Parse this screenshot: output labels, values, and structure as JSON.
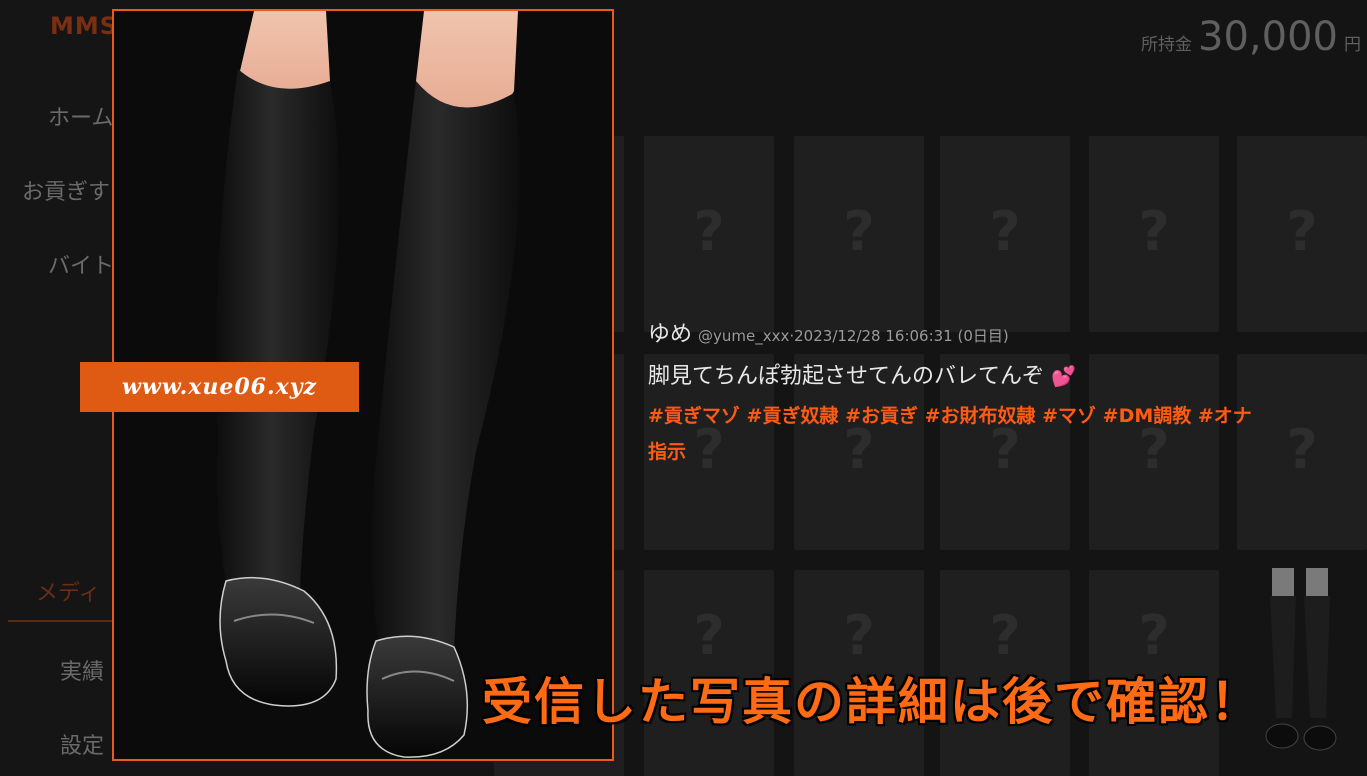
{
  "sidebar": {
    "logo": "MMS",
    "items": [
      {
        "label": "ホーム"
      },
      {
        "label": "お貢ぎす"
      },
      {
        "label": "バイト"
      }
    ],
    "section_label": "メディ",
    "sub_items": [
      {
        "label": "実績"
      },
      {
        "label": "設定"
      }
    ]
  },
  "wallet": {
    "label": "所持金",
    "amount": "30,000",
    "unit": "円"
  },
  "grid": {
    "placeholder": "?"
  },
  "post": {
    "name": "ゆめ",
    "meta": "@yume_xxx·2023/12/28 16:06:31 (0日目)",
    "text": "脚見てちんぽ勃起させてんのバレてんぞ",
    "emoji": "💕",
    "tags": "#貢ぎマゾ #貢ぎ奴隷 #お貢ぎ #お財布奴隷 #マゾ #DM調教 #オナ指示"
  },
  "watermark": "www.xue06.xyz",
  "caption": "受信した写真の詳細は後で確認！",
  "colors": {
    "accent": "#ff5a14",
    "frame": "#e85b1a",
    "background": "#141414",
    "card": "#1f1f1f"
  }
}
